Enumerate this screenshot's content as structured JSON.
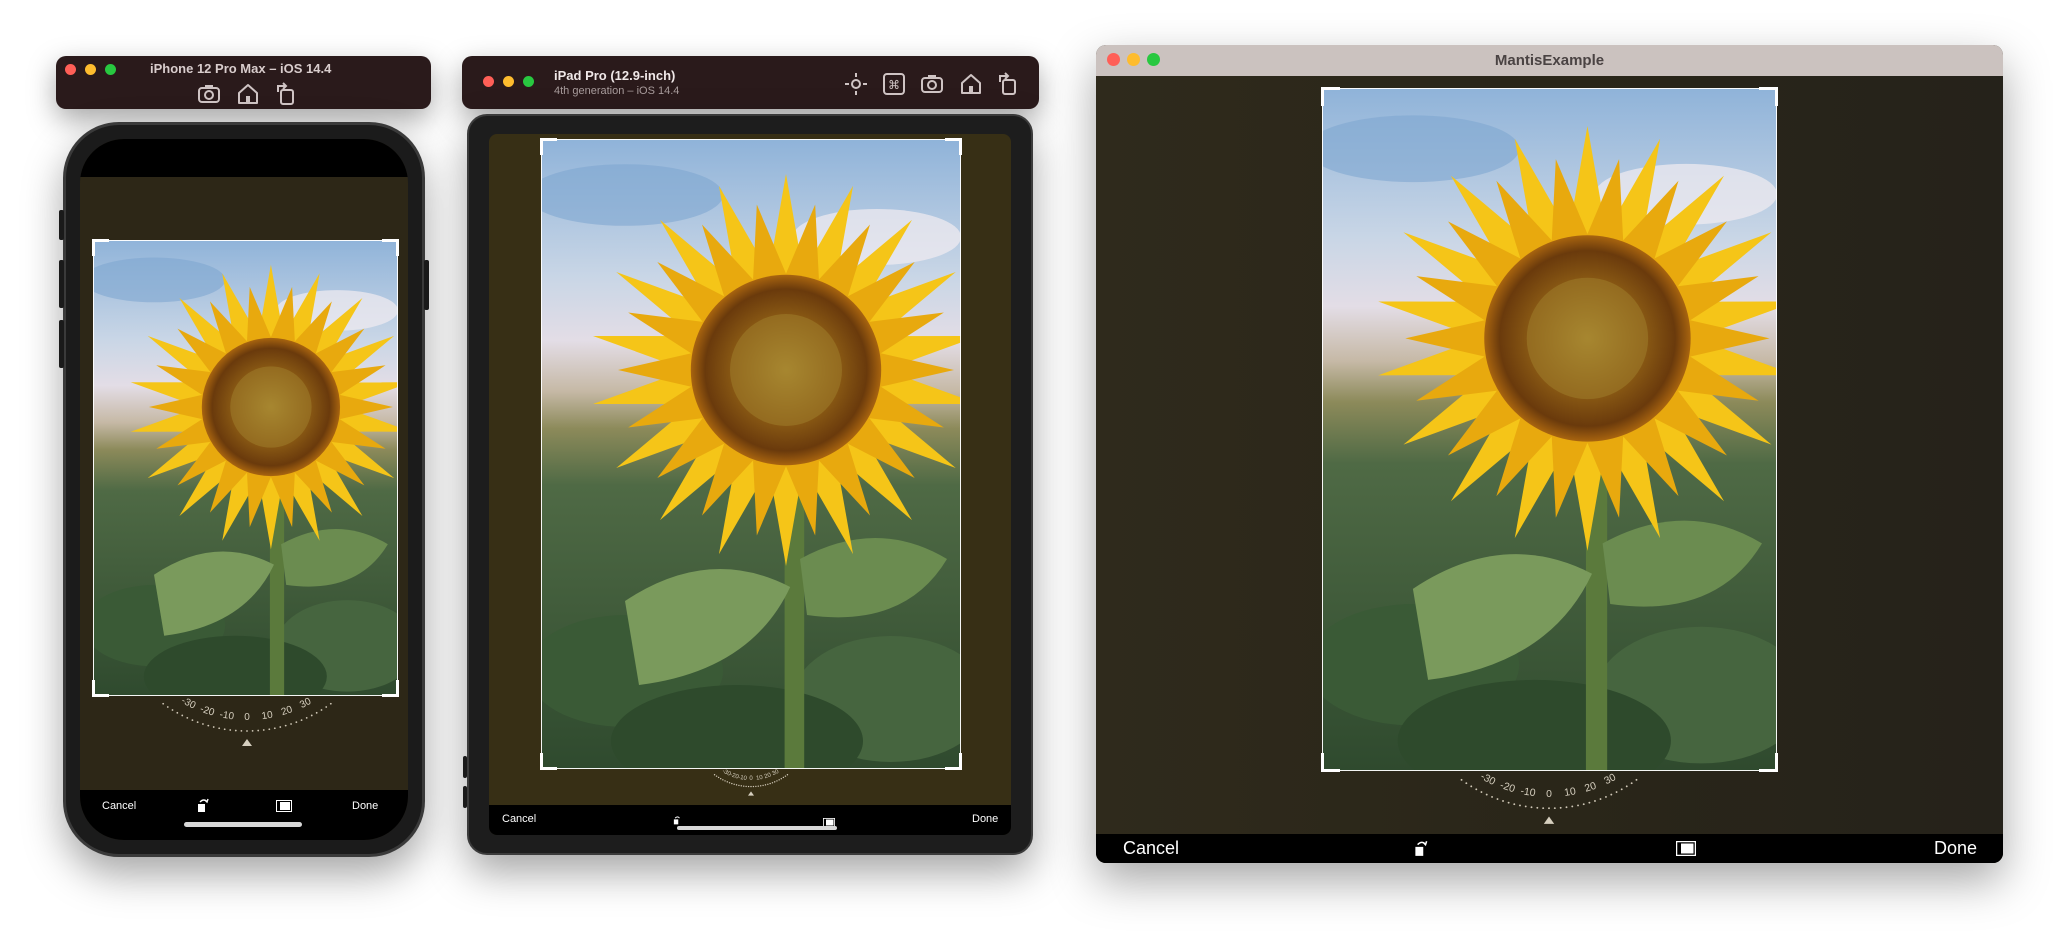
{
  "iphone": {
    "title": "iPhone 12 Pro Max – iOS 14.4",
    "toolbar": {
      "cancel": "Cancel",
      "done": "Done"
    },
    "dial": {
      "labels": [
        "-30",
        "-20",
        "-10",
        "0",
        "10",
        "20",
        "30"
      ]
    }
  },
  "ipad": {
    "title": "iPad Pro (12.9-inch)",
    "subtitle": "4th generation – iOS 14.4",
    "toolbar": {
      "cancel": "Cancel",
      "done": "Done"
    },
    "dial": {
      "labels": [
        "-30",
        "-20",
        "-10",
        "0",
        "10",
        "20",
        "30"
      ]
    }
  },
  "mac": {
    "title": "MantisExample",
    "toolbar": {
      "cancel": "Cancel",
      "done": "Done"
    },
    "dial": {
      "labels": [
        "-30",
        "-20",
        "-10",
        "0",
        "10",
        "20",
        "30"
      ]
    }
  },
  "icons": {
    "simulator_toolbar": [
      "screenshot-icon",
      "home-icon",
      "rotate-icon"
    ],
    "ipad_toolbar": [
      "brightness-icon",
      "keyboard-icon",
      "screenshot-icon",
      "home-icon",
      "rotate-icon"
    ],
    "crop_toolbar": [
      "rotate-left-icon",
      "aspect-ratio-icon"
    ]
  },
  "colors": {
    "app_background": "#2d2717",
    "mac_background": "#2a2619",
    "simulator_bar": "#2a1a1b",
    "traffic_red": "#ff5f57",
    "traffic_yellow": "#febc2e",
    "traffic_green": "#28c840"
  }
}
